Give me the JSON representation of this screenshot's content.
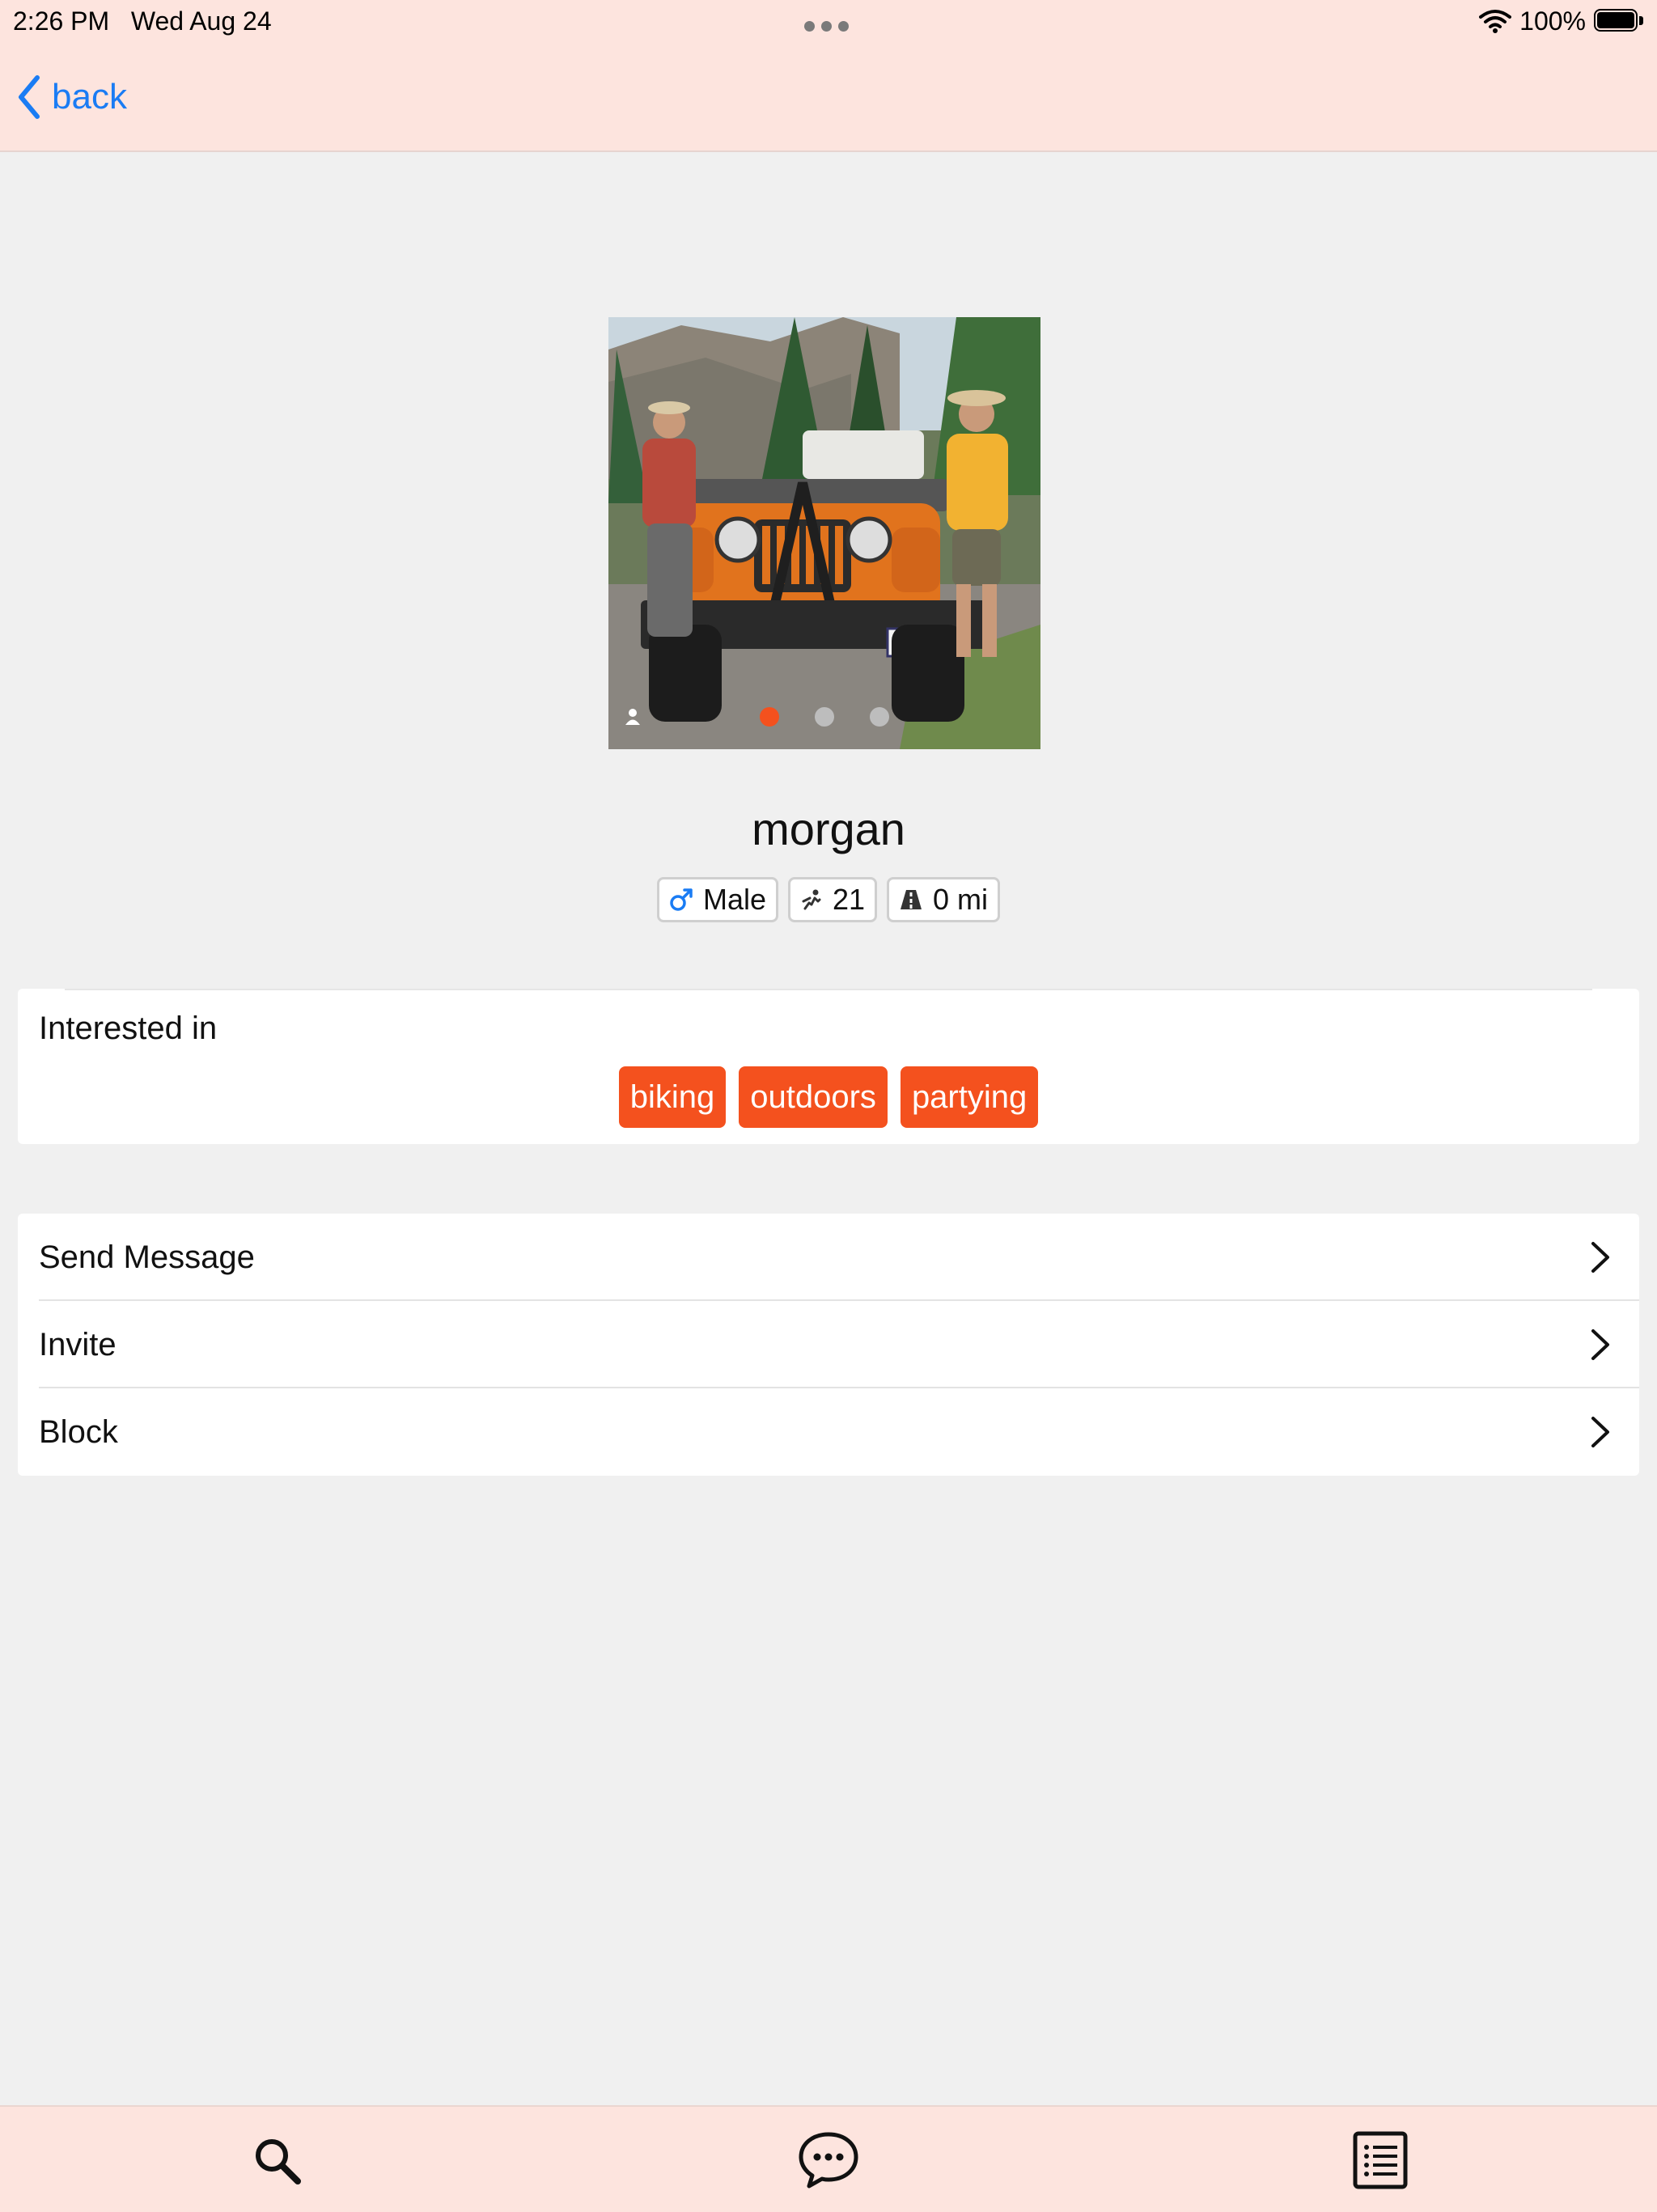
{
  "status_bar": {
    "time": "2:26 PM",
    "date": "Wed Aug 24",
    "battery": "100%"
  },
  "nav": {
    "back_label": "back"
  },
  "profile": {
    "name": "morgan",
    "photos": {
      "count": 3,
      "active_index": 0
    },
    "badges": [
      {
        "icon": "male-symbol-icon",
        "value": "Male"
      },
      {
        "icon": "age-icon",
        "value": "21"
      },
      {
        "icon": "road-distance-icon",
        "value": "0 mi"
      }
    ]
  },
  "interests": {
    "title": "Interested in",
    "tags": [
      "biking",
      "outdoors",
      "partying"
    ]
  },
  "actions": [
    {
      "label": "Send Message"
    },
    {
      "label": "Invite"
    },
    {
      "label": "Block"
    }
  ],
  "tab_bar": {
    "items": [
      "search-icon",
      "chat-bubble-icon",
      "list-icon"
    ]
  },
  "colors": {
    "accent": "#f4511e",
    "link": "#1a7cf4",
    "bars": "#fde4de",
    "background": "#f0f0f0"
  }
}
